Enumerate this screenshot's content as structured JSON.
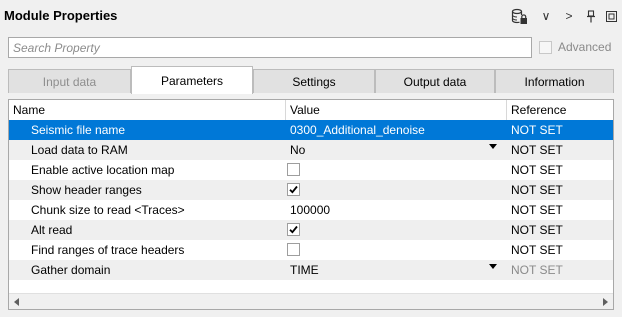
{
  "window": {
    "title": "Module Properties"
  },
  "toolbar": {
    "icons": [
      "database-lock-icon",
      "chevron-down-icon",
      "chevron-right-icon",
      "pin-icon",
      "restore-icon"
    ],
    "chevron_down": "∨",
    "chevron_right": ">"
  },
  "search": {
    "placeholder": "Search Property",
    "value": ""
  },
  "advanced": {
    "label": "Advanced",
    "checked": false,
    "enabled": false
  },
  "tabs": [
    {
      "label": "Input data",
      "state": "disabled"
    },
    {
      "label": "Parameters",
      "state": "active"
    },
    {
      "label": "Settings",
      "state": "normal"
    },
    {
      "label": "Output data",
      "state": "normal"
    },
    {
      "label": "Information",
      "state": "normal"
    }
  ],
  "grid": {
    "columns": [
      "Name",
      "Value",
      "Reference"
    ],
    "rows": [
      {
        "name": "Seismic file name",
        "value": "0300_Additional_denoise",
        "type": "text",
        "reference": "NOT SET",
        "selected": true
      },
      {
        "name": "Load data to RAM",
        "value": "No",
        "type": "dropdown",
        "reference": "NOT SET"
      },
      {
        "name": "Enable active location map",
        "type": "checkbox",
        "checked": false,
        "reference": "NOT SET"
      },
      {
        "name": "Show header ranges",
        "type": "checkbox",
        "checked": true,
        "reference": "NOT SET"
      },
      {
        "name": "Chunk size to read <Traces>",
        "value": "100000",
        "type": "text",
        "reference": "NOT SET"
      },
      {
        "name": "Alt read",
        "type": "checkbox",
        "checked": true,
        "reference": "NOT SET"
      },
      {
        "name": "Find ranges of trace headers",
        "type": "checkbox",
        "checked": false,
        "reference": "NOT SET"
      },
      {
        "name": "Gather domain",
        "value": "TIME",
        "type": "dropdown",
        "reference": "NOT SET",
        "reference_dimmed": true
      }
    ]
  },
  "scrollbar": {
    "left_arrow": "◂",
    "right_arrow": "▸"
  },
  "colors": {
    "selection": "#0078d7",
    "alt_row": "#efefef",
    "background": "#f0f0f0"
  }
}
